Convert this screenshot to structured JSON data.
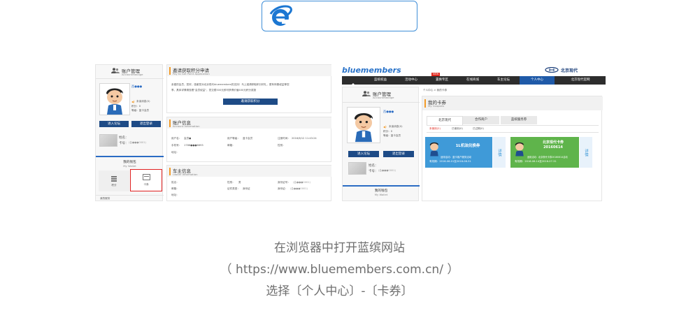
{
  "caption": {
    "line1": "在浏览器中打开蓝缤网站",
    "line2": "（ https://www.bluemembers.com.cn/ ）",
    "line3": "选择〔个人中心〕-〔卡券〕"
  },
  "left": {
    "sidebar": {
      "account_title": "账户管理",
      "account_sub": "AccountManage",
      "username": "西●●●",
      "unread": "未读消息(0)",
      "points": "积分：0",
      "level": "等级：蓝卡会员",
      "btn_forum": "进入论坛",
      "btn_logout": "退出登录",
      "name_label": "姓名：",
      "card_label": "卡号：",
      "card_value": "(会●●●0001)",
      "wallet_title": "我的钱包",
      "wallet_sub": "My Wallet",
      "wallet_item1": "积分",
      "wallet_item2": "卡券",
      "bottom_label": "我的服务"
    },
    "main": {
      "apply_title": "邀请获取积分申请",
      "apply_sub": "Pay to Get Point Application",
      "apply_text1": "亲爱的会员，您好。感谢您对北京现代bluemembers的支持！马上邀请获取积分好礼，更有惊喜权益等您",
      "apply_text2": "享。具体详情请查看\"会员权益\"，您交费500元即可获得价值400元积分奖励",
      "apply_button": "邀请获取积分",
      "account_title": "账户信息",
      "account_sub": "Account Information",
      "account_fields": [
        {
          "label": "用户名：",
          "value": "会员●"
        },
        {
          "label": "用户等级：",
          "value": "蓝卡会员"
        },
        {
          "label": "注册时间：",
          "value": "2016/6/12 11:43:24"
        },
        {
          "label": "手机号：",
          "value": "1786●●●6693"
        },
        {
          "label": "邮箱：",
          "value": ""
        },
        {
          "label": "性别：",
          "value": ""
        },
        {
          "label": "地址：",
          "value": ""
        }
      ],
      "owner_title": "车主信息",
      "owner_sub": "Owner Information",
      "owner_fields": [
        {
          "label": "姓名：",
          "value": ""
        },
        {
          "label": "性别：",
          "value": "男"
        },
        {
          "label": "身份证号：",
          "value": "(会●●●0001)"
        },
        {
          "label": "邮箱：",
          "value": ""
        },
        {
          "label": "证件类型：",
          "value": "身份证"
        },
        {
          "label": "身份证：",
          "value": "(会●●●0001)"
        },
        {
          "label": "地址：",
          "value": ""
        }
      ]
    }
  },
  "right": {
    "logo": "bluemembers",
    "brand": "北京现代",
    "nav": [
      "",
      "蓝缤权益",
      "活动中心",
      "置换专区",
      "在线商城",
      "车主论坛",
      "个人中心",
      "北京现代官网"
    ],
    "nav_badge": "NEW",
    "breadcrumb": "个人中心 > 我的卡券",
    "coupons_title": "我的卡券",
    "coupons_sub": "My Coupons",
    "tabs": [
      "北京现代",
      "合作商户",
      "蓝缤服务券"
    ],
    "subtabs": [
      "未使用(2)",
      "已使用(0)",
      "已过期(0)"
    ],
    "coupon1": {
      "title": "1L机油兑换券",
      "line1": "适用活动：蓝卡客户服务活动",
      "line2": "有效期：2016-06-01至2016-08-31",
      "detail": "详情",
      "color": "#3f9ad8"
    },
    "coupon2": {
      "title": "北京现代卡券",
      "code": "20160614",
      "line1": "适用活动：北京现代卡券20160614活动",
      "line2": "有效期：2016-06-14至2016-07-31",
      "detail": "详情",
      "color": "#5fb44b"
    },
    "sidebar": {
      "account_title": "账户管理",
      "account_sub": "AccountManage",
      "username": "西●●●",
      "unread": "未读消息(0)",
      "points": "积分：0",
      "level": "等级：蓝卡会员",
      "btn_forum": "进入论坛",
      "btn_logout": "退出登录",
      "name_label": "姓名：",
      "card_label": "卡号：",
      "card_value": "(会●●●0001)",
      "wallet_title": "我的钱包",
      "wallet_sub": "My Wallet"
    }
  }
}
